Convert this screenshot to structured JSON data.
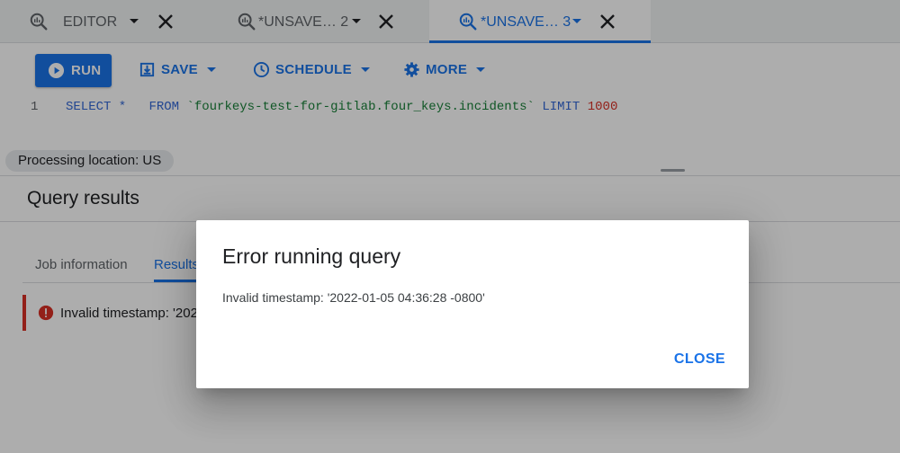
{
  "tabs": [
    {
      "label": "EDITOR",
      "active": false
    },
    {
      "label": "*UNSAVE… 2",
      "active": false
    },
    {
      "label": "*UNSAVE… 3",
      "active": true
    }
  ],
  "toolbar": {
    "run_label": "RUN",
    "save_label": "SAVE",
    "schedule_label": "SCHEDULE",
    "more_label": "MORE"
  },
  "editor": {
    "line_number": "1",
    "query_keyword_select": "SELECT *",
    "query_keyword_from": "FROM",
    "query_table": "`fourkeys-test-for-gitlab.four_keys.incidents`",
    "query_keyword_limit": "LIMIT",
    "query_limit_value": "1000"
  },
  "status": {
    "processing_location": "Processing location: US"
  },
  "results": {
    "title": "Query results",
    "tabs": [
      "Job information",
      "Results"
    ],
    "error_text": "Invalid timestamp: '2022"
  },
  "dialog": {
    "title": "Error running query",
    "message": "Invalid timestamp: '2022-01-05 04:36:28 -0800'",
    "close_label": "CLOSE"
  },
  "colors": {
    "accent": "#1a73e8",
    "error": "#d93025",
    "scrim": "rgba(0,0,0,0.32)"
  },
  "icons": {
    "tab": "query-magnifier-icon",
    "close": "close-icon",
    "run": "play-icon",
    "save": "save-icon",
    "schedule": "clock-icon",
    "more": "gear-icon",
    "error": "error-icon"
  }
}
